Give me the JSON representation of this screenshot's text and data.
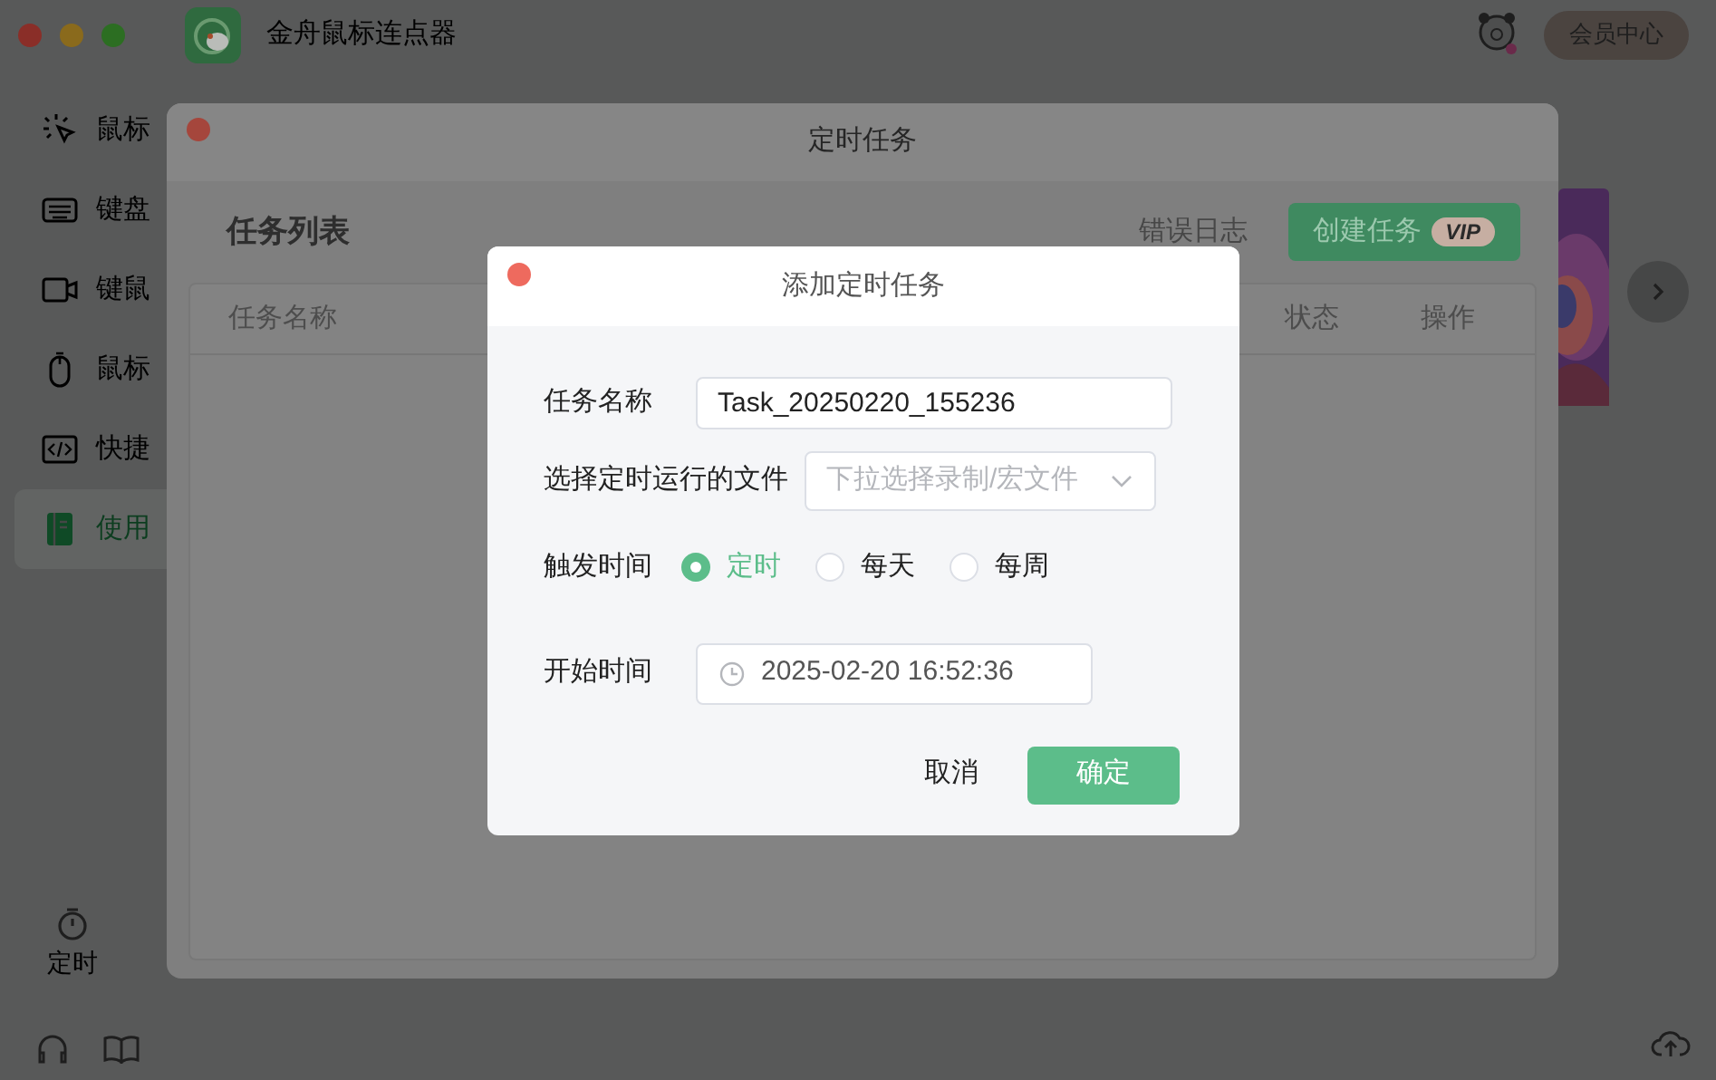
{
  "app": {
    "title": "金舟鼠标连点器",
    "member_button": "会员中心"
  },
  "sidebar": {
    "items": [
      {
        "label": "鼠标",
        "selected": false
      },
      {
        "label": "键盘",
        "selected": false
      },
      {
        "label": "键鼠",
        "selected": false
      },
      {
        "label": "鼠标",
        "selected": false
      },
      {
        "label": "快捷",
        "selected": false
      },
      {
        "label": "使用",
        "selected": true
      }
    ],
    "bottom_item": "定时"
  },
  "timer_window": {
    "title": "定时任务",
    "heading": "任务列表",
    "error_log": "错误日志",
    "create_button": "创建任务",
    "vip_badge": "VIP",
    "columns": [
      "任务名称",
      "状态",
      "操作"
    ]
  },
  "dialog": {
    "title": "添加定时任务",
    "fields": [
      {
        "kind": "text",
        "label": "任务名称",
        "value": "Task_20250220_155236"
      },
      {
        "kind": "select",
        "label": "选择定时运行的文件",
        "placeholder": "下拉选择录制/宏文件"
      },
      {
        "kind": "radio",
        "label": "触发时间",
        "options": [
          {
            "label": "定时",
            "selected": true
          },
          {
            "label": "每天",
            "selected": false
          },
          {
            "label": "每周",
            "selected": false
          }
        ]
      },
      {
        "kind": "time",
        "label": "开始时间",
        "value": "2025-02-20 16:52:36"
      }
    ],
    "cancel": "取消",
    "ok": "确定"
  }
}
